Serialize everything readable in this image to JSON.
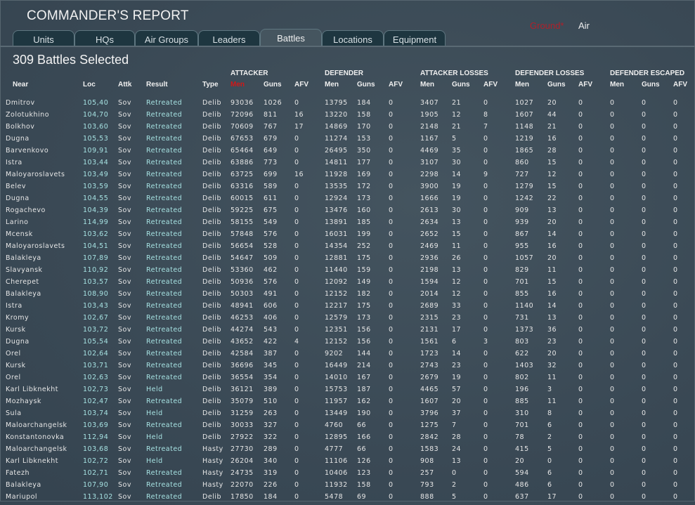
{
  "header": {
    "title": "COMMANDER'S REPORT",
    "mode_ground": "Ground*",
    "mode_air": "Air"
  },
  "tabs": [
    "Units",
    "HQs",
    "Air Groups",
    "Leaders",
    "Battles",
    "Locations",
    "Equipment"
  ],
  "active_tab": "Battles",
  "summary": "309 Battles Selected",
  "groups": [
    "ATTACKER",
    "DEFENDER",
    "ATTACKER LOSSES",
    "DEFENDER LOSSES",
    "DEFENDER ESCAPED"
  ],
  "columns": [
    "Near",
    "Loc",
    "Attk",
    "Result",
    "Type",
    "Men",
    "Guns",
    "AFV",
    "Men",
    "Guns",
    "AFV",
    "Men",
    "Guns",
    "AFV",
    "Men",
    "Guns",
    "AFV",
    "Men",
    "Guns",
    "AFV"
  ],
  "sorted_column": 5,
  "colors": {
    "sorted": "#d01818",
    "ground": "#b0202a",
    "link": "#a6e2e2"
  },
  "rows": [
    [
      "Dmitrov",
      "105,40",
      "Sov",
      "Retreated",
      "Delib",
      "93036",
      "1026",
      "0",
      "13795",
      "184",
      "0",
      "3407",
      "21",
      "0",
      "1027",
      "20",
      "0",
      "0",
      "0",
      "0"
    ],
    [
      "Zolotukhino",
      "104,70",
      "Sov",
      "Retreated",
      "Delib",
      "72096",
      "811",
      "16",
      "13220",
      "158",
      "0",
      "1905",
      "12",
      "8",
      "1607",
      "44",
      "0",
      "0",
      "0",
      "0"
    ],
    [
      "Bolkhov",
      "103,60",
      "Sov",
      "Retreated",
      "Delib",
      "70609",
      "767",
      "17",
      "14869",
      "170",
      "0",
      "2148",
      "21",
      "7",
      "1148",
      "21",
      "0",
      "0",
      "0",
      "0"
    ],
    [
      "Dugna",
      "105,53",
      "Sov",
      "Retreated",
      "Delib",
      "67653",
      "679",
      "0",
      "11274",
      "153",
      "0",
      "1167",
      "5",
      "0",
      "1219",
      "16",
      "0",
      "0",
      "0",
      "0"
    ],
    [
      "Barvenkovo",
      "109,91",
      "Sov",
      "Retreated",
      "Delib",
      "65464",
      "649",
      "0",
      "26495",
      "350",
      "0",
      "4469",
      "35",
      "0",
      "1865",
      "28",
      "0",
      "0",
      "0",
      "0"
    ],
    [
      "Istra",
      "103,44",
      "Sov",
      "Retreated",
      "Delib",
      "63886",
      "773",
      "0",
      "14811",
      "177",
      "0",
      "3107",
      "30",
      "0",
      "860",
      "15",
      "0",
      "0",
      "0",
      "0"
    ],
    [
      "Maloyaroslavets",
      "103,49",
      "Sov",
      "Retreated",
      "Delib",
      "63725",
      "699",
      "16",
      "11928",
      "169",
      "0",
      "2298",
      "14",
      "9",
      "727",
      "12",
      "0",
      "0",
      "0",
      "0"
    ],
    [
      "Belev",
      "103,59",
      "Sov",
      "Retreated",
      "Delib",
      "63316",
      "589",
      "0",
      "13535",
      "172",
      "0",
      "3900",
      "19",
      "0",
      "1279",
      "15",
      "0",
      "0",
      "0",
      "0"
    ],
    [
      "Dugna",
      "104,55",
      "Sov",
      "Retreated",
      "Delib",
      "60015",
      "611",
      "0",
      "12924",
      "173",
      "0",
      "1666",
      "19",
      "0",
      "1242",
      "22",
      "0",
      "0",
      "0",
      "0"
    ],
    [
      "Rogachevo",
      "104,39",
      "Sov",
      "Retreated",
      "Delib",
      "59225",
      "675",
      "0",
      "13476",
      "160",
      "0",
      "2613",
      "30",
      "0",
      "909",
      "13",
      "0",
      "0",
      "0",
      "0"
    ],
    [
      "Larino",
      "114,99",
      "Sov",
      "Retreated",
      "Delib",
      "58155",
      "549",
      "0",
      "13891",
      "185",
      "0",
      "2634",
      "13",
      "0",
      "939",
      "20",
      "0",
      "0",
      "0",
      "0"
    ],
    [
      "Mcensk",
      "103,62",
      "Sov",
      "Retreated",
      "Delib",
      "57848",
      "576",
      "0",
      "16031",
      "199",
      "0",
      "2652",
      "15",
      "0",
      "867",
      "14",
      "0",
      "0",
      "0",
      "0"
    ],
    [
      "Maloyaroslavets",
      "104,51",
      "Sov",
      "Retreated",
      "Delib",
      "56654",
      "528",
      "0",
      "14354",
      "252",
      "0",
      "2469",
      "11",
      "0",
      "955",
      "16",
      "0",
      "0",
      "0",
      "0"
    ],
    [
      "Balakleya",
      "107,89",
      "Sov",
      "Retreated",
      "Delib",
      "54647",
      "509",
      "0",
      "12881",
      "175",
      "0",
      "2936",
      "26",
      "0",
      "1057",
      "20",
      "0",
      "0",
      "0",
      "0"
    ],
    [
      "Slavyansk",
      "110,92",
      "Sov",
      "Retreated",
      "Delib",
      "53360",
      "462",
      "0",
      "11440",
      "159",
      "0",
      "2198",
      "13",
      "0",
      "829",
      "11",
      "0",
      "0",
      "0",
      "0"
    ],
    [
      "Cherepet",
      "103,57",
      "Sov",
      "Retreated",
      "Delib",
      "50936",
      "576",
      "0",
      "12092",
      "149",
      "0",
      "1594",
      "12",
      "0",
      "701",
      "15",
      "0",
      "0",
      "0",
      "0"
    ],
    [
      "Balakleya",
      "108,90",
      "Sov",
      "Retreated",
      "Delib",
      "50303",
      "491",
      "0",
      "12152",
      "182",
      "0",
      "2014",
      "12",
      "0",
      "855",
      "16",
      "0",
      "0",
      "0",
      "0"
    ],
    [
      "Istra",
      "103,43",
      "Sov",
      "Retreated",
      "Delib",
      "48941",
      "606",
      "0",
      "12217",
      "175",
      "0",
      "2689",
      "33",
      "0",
      "1140",
      "14",
      "0",
      "0",
      "0",
      "0"
    ],
    [
      "Kromy",
      "102,67",
      "Sov",
      "Retreated",
      "Delib",
      "46253",
      "406",
      "0",
      "12579",
      "173",
      "0",
      "2315",
      "23",
      "0",
      "731",
      "13",
      "0",
      "0",
      "0",
      "0"
    ],
    [
      "Kursk",
      "103,72",
      "Sov",
      "Retreated",
      "Delib",
      "44274",
      "543",
      "0",
      "12351",
      "156",
      "0",
      "2131",
      "17",
      "0",
      "1373",
      "36",
      "0",
      "0",
      "0",
      "0"
    ],
    [
      "Dugna",
      "105,54",
      "Sov",
      "Retreated",
      "Delib",
      "43652",
      "422",
      "4",
      "12152",
      "156",
      "0",
      "1561",
      "6",
      "3",
      "803",
      "23",
      "0",
      "0",
      "0",
      "0"
    ],
    [
      "Orel",
      "102,64",
      "Sov",
      "Retreated",
      "Delib",
      "42584",
      "387",
      "0",
      "9202",
      "144",
      "0",
      "1723",
      "14",
      "0",
      "622",
      "20",
      "0",
      "0",
      "0",
      "0"
    ],
    [
      "Kursk",
      "103,71",
      "Sov",
      "Retreated",
      "Delib",
      "36696",
      "345",
      "0",
      "16449",
      "214",
      "0",
      "2743",
      "23",
      "0",
      "1403",
      "32",
      "0",
      "0",
      "0",
      "0"
    ],
    [
      "Orel",
      "102,63",
      "Sov",
      "Retreated",
      "Delib",
      "36554",
      "354",
      "0",
      "14010",
      "167",
      "0",
      "2679",
      "19",
      "0",
      "802",
      "11",
      "0",
      "0",
      "0",
      "0"
    ],
    [
      "Karl Libknekht",
      "102,73",
      "Sov",
      "Held",
      "Delib",
      "36121",
      "389",
      "0",
      "15753",
      "187",
      "0",
      "4465",
      "57",
      "0",
      "196",
      "3",
      "0",
      "0",
      "0",
      "0"
    ],
    [
      "Mozhaysk",
      "102,47",
      "Sov",
      "Retreated",
      "Delib",
      "35079",
      "510",
      "0",
      "11957",
      "162",
      "0",
      "1607",
      "20",
      "0",
      "885",
      "11",
      "0",
      "0",
      "0",
      "0"
    ],
    [
      "Sula",
      "103,74",
      "Sov",
      "Held",
      "Delib",
      "31259",
      "263",
      "0",
      "13449",
      "190",
      "0",
      "3796",
      "37",
      "0",
      "310",
      "8",
      "0",
      "0",
      "0",
      "0"
    ],
    [
      "Maloarchangelsk",
      "103,69",
      "Sov",
      "Retreated",
      "Delib",
      "30033",
      "327",
      "0",
      "4760",
      "66",
      "0",
      "1275",
      "7",
      "0",
      "701",
      "6",
      "0",
      "0",
      "0",
      "0"
    ],
    [
      "Konstantonovka",
      "112,94",
      "Sov",
      "Held",
      "Delib",
      "27922",
      "322",
      "0",
      "12895",
      "166",
      "0",
      "2842",
      "28",
      "0",
      "78",
      "2",
      "0",
      "0",
      "0",
      "0"
    ],
    [
      "Maloarchangelsk",
      "103,68",
      "Sov",
      "Retreated",
      "Hasty",
      "27730",
      "289",
      "0",
      "4777",
      "66",
      "0",
      "1583",
      "24",
      "0",
      "415",
      "5",
      "0",
      "0",
      "0",
      "0"
    ],
    [
      "Karl Libknekht",
      "102,72",
      "Sov",
      "Held",
      "Hasty",
      "26204",
      "340",
      "0",
      "11106",
      "126",
      "0",
      "908",
      "13",
      "0",
      "20",
      "0",
      "0",
      "0",
      "0",
      "0"
    ],
    [
      "Fatezh",
      "102,71",
      "Sov",
      "Retreated",
      "Hasty",
      "24735",
      "319",
      "0",
      "10406",
      "123",
      "0",
      "257",
      "0",
      "0",
      "594",
      "6",
      "0",
      "0",
      "0",
      "0"
    ],
    [
      "Balakleya",
      "107,90",
      "Sov",
      "Retreated",
      "Hasty",
      "22070",
      "226",
      "0",
      "11932",
      "158",
      "0",
      "793",
      "2",
      "0",
      "486",
      "6",
      "0",
      "0",
      "0",
      "0"
    ],
    [
      "Mariupol",
      "113,102",
      "Sov",
      "Retreated",
      "Delib",
      "17850",
      "184",
      "0",
      "5478",
      "69",
      "0",
      "888",
      "5",
      "0",
      "637",
      "17",
      "0",
      "0",
      "0",
      "0"
    ]
  ]
}
